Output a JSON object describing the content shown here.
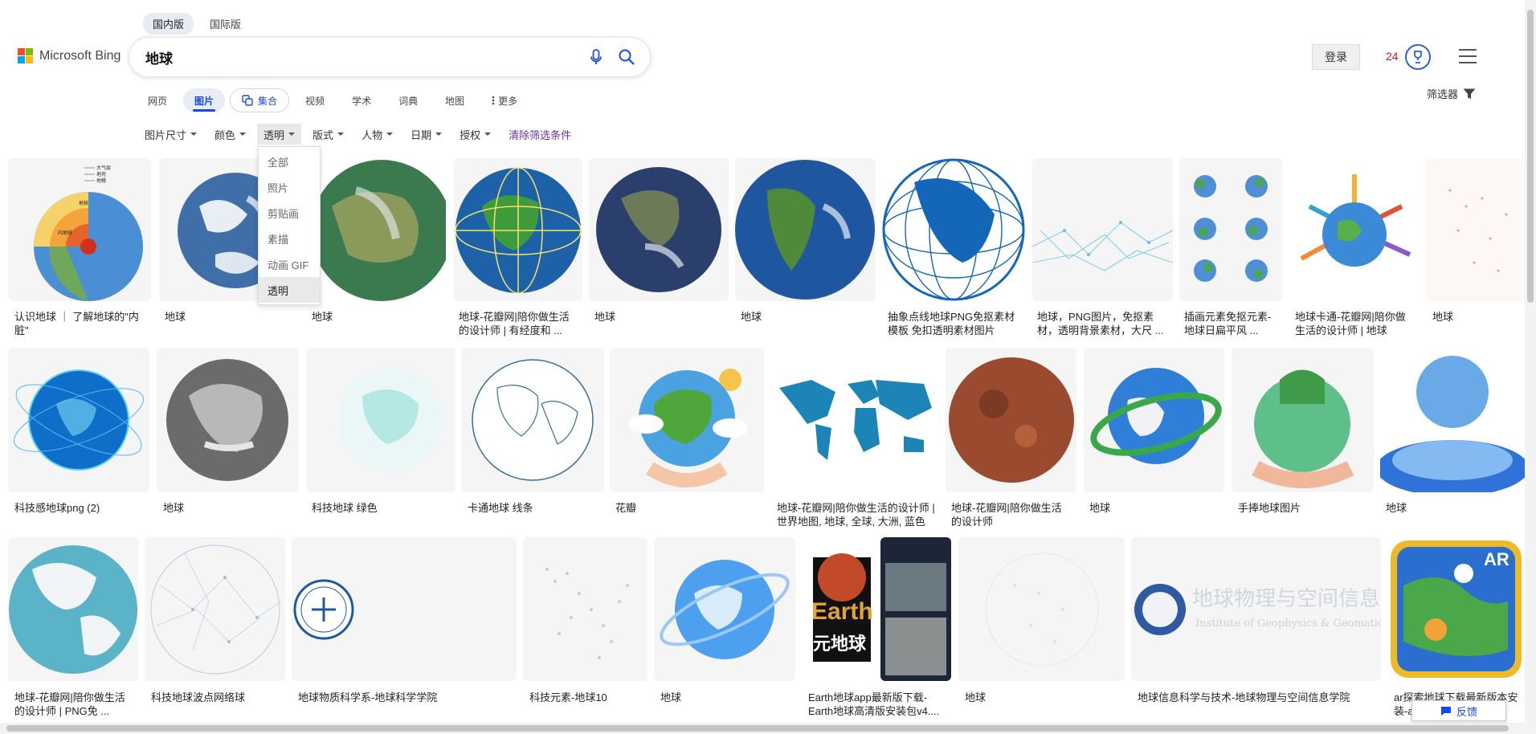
{
  "region_tabs": [
    "国内版",
    "国际版"
  ],
  "logo": {
    "text": "Microsoft Bing"
  },
  "search": {
    "value": "地球"
  },
  "header": {
    "login_label": "登录",
    "rewards_count": "24"
  },
  "nav_tabs": [
    "网页",
    "图片",
    "集合",
    "视频",
    "学术",
    "词典",
    "地图",
    "更多"
  ],
  "filter_toggle_label": "筛选器",
  "filters": [
    "图片尺寸",
    "颜色",
    "透明",
    "版式",
    "人物",
    "日期",
    "授权"
  ],
  "filter_clear": "清除筛选条件",
  "dropdown_items": [
    "全部",
    "照片",
    "剪贴画",
    "素描",
    "动画 GIF",
    "透明"
  ],
  "row1_captions": [
    "认识地球 ｜ 了解地球的\"内脏\"",
    "地球",
    "地球",
    "地球-花瓣网|陪你做生活的设计师 | 有经度和 ...",
    "地球",
    "地球",
    "抽象点线地球PNG免抠素材模板 免扣透明素材图片",
    "地球，PNG图片，免抠素材，透明背景素材，大尺 ...",
    "插画元素免抠元素-地球日扁平风 ...",
    "地球卡通-花瓣网|陪你做生活的设计师 | 地球",
    "地球"
  ],
  "row2_captions": [
    "科技感地球png (2)",
    "地球",
    "科技地球 绿色",
    "卡通地球 线条",
    "花瓣",
    "地球-花瓣网|陪你做生活的设计师 | 世界地图, 地球, 全球, 大洲, 蓝色",
    "地球-花瓣网|陪你做生活的设计师",
    "地球",
    "手捧地球图片",
    "地球"
  ],
  "row3_captions": [
    "地球-花瓣网|陪你做生活的设计师 | PNG免 ...",
    "科技地球波点网络球",
    "地球物质科学系-地球科学学院",
    "科技元素-地球10",
    "地球",
    "Earth地球app最新版下载-Earth地球高清版安装包v4....",
    "地球",
    "地球信息科学与技术-地球物理与空间信息学院",
    "ar探索地球下载最新版本安装-ar..."
  ],
  "image_text": {
    "earth_core_labels": [
      "大气层",
      "地壳",
      "地幔",
      "地核",
      "内地核"
    ],
    "earth_app": [
      "Earth",
      "元地球"
    ],
    "geophysics": "地球物理与空间信息学院",
    "geophysics_en": "Institute of Geophysics & Geomatics",
    "ar_badge": "AR"
  },
  "feedback_label": "反馈",
  "colors": {
    "accent": "#174ae4",
    "ms_red": "#f25022",
    "ms_green": "#7fba00",
    "ms_blue": "#00a4ef",
    "ms_yellow": "#ffb900",
    "clear_filter": "#6234a7"
  },
  "icons": [
    "microphone-icon",
    "search-icon",
    "rewards-icon",
    "menu-icon",
    "filter-icon",
    "collection-icon",
    "more-icon",
    "feedback-icon"
  ]
}
